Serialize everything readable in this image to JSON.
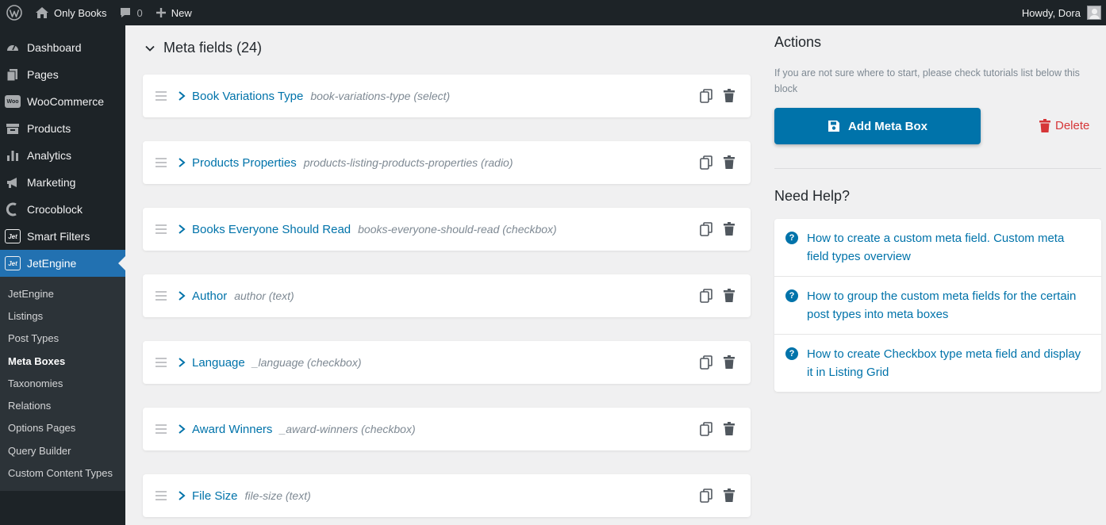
{
  "admin_bar": {
    "site_name": "Only Books",
    "comments_count": "0",
    "new_label": "New",
    "greeting": "Howdy, Dora"
  },
  "sidebar": {
    "menu": [
      {
        "label": "Dashboard",
        "icon": "dashboard-icon"
      },
      {
        "label": "Pages",
        "icon": "pages-icon"
      },
      {
        "label": "WooCommerce",
        "icon": "woocommerce-icon"
      },
      {
        "label": "Products",
        "icon": "products-icon"
      },
      {
        "label": "Analytics",
        "icon": "analytics-icon"
      },
      {
        "label": "Marketing",
        "icon": "megaphone-icon"
      },
      {
        "label": "Crocoblock",
        "icon": "crocoblock-icon"
      },
      {
        "label": "Smart Filters",
        "icon": "jet-icon"
      },
      {
        "label": "JetEngine",
        "icon": "jet-icon"
      }
    ],
    "submenu": [
      "JetEngine",
      "Listings",
      "Post Types",
      "Meta Boxes",
      "Taxonomies",
      "Relations",
      "Options Pages",
      "Query Builder",
      "Custom Content Types"
    ],
    "current_submenu": "Meta Boxes"
  },
  "meta_fields": {
    "header": "Meta fields (24)",
    "items": [
      {
        "name": "Book Variations Type",
        "slug": "book-variations-type (select)"
      },
      {
        "name": "Products Properties",
        "slug": "products-listing-products-properties (radio)"
      },
      {
        "name": "Books Everyone Should Read",
        "slug": "books-everyone-should-read (checkbox)"
      },
      {
        "name": "Author",
        "slug": "author (text)"
      },
      {
        "name": "Language",
        "slug": "_language (checkbox)"
      },
      {
        "name": "Award Winners",
        "slug": "_award-winners (checkbox)"
      },
      {
        "name": "File Size",
        "slug": "file-size (text)"
      }
    ]
  },
  "actions": {
    "title": "Actions",
    "note": "If you are not sure where to start, please check tutorials list below this block",
    "add_button": "Add Meta Box",
    "delete_label": "Delete"
  },
  "help": {
    "title": "Need Help?",
    "items": [
      "How to create a custom meta field. Custom meta field types overview",
      "How to group the custom meta fields for the certain post types into meta boxes",
      "How to create Checkbox type meta field and display it in Listing Grid"
    ]
  },
  "colors": {
    "accent": "#0073aa",
    "admin_bg": "#1d2327",
    "active_menu": "#2271b1",
    "delete": "#d63638"
  }
}
